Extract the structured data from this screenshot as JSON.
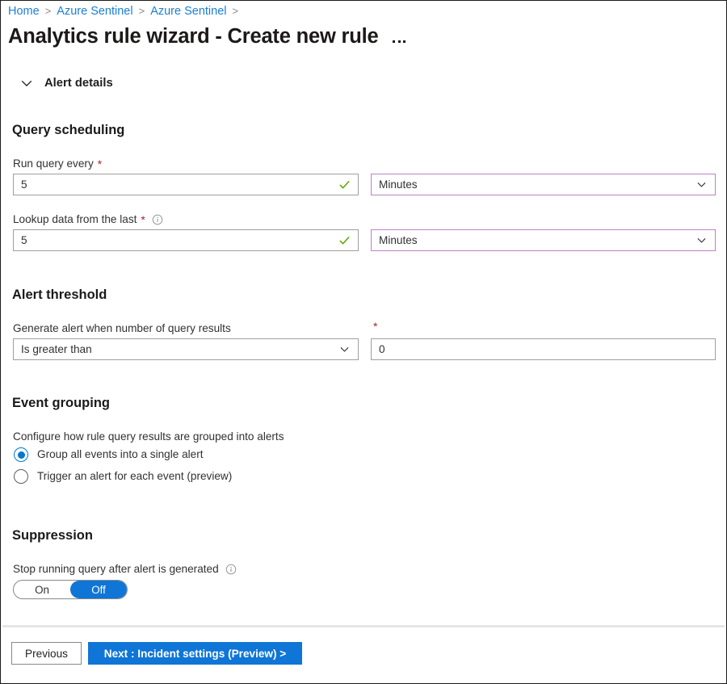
{
  "breadcrumb": {
    "items": [
      {
        "label": "Home"
      },
      {
        "label": "Azure Sentinel"
      },
      {
        "label": "Azure Sentinel"
      }
    ],
    "separator": ">"
  },
  "header": {
    "title": "Analytics rule wizard - Create new rule",
    "more_menu": "..."
  },
  "alert_details": {
    "label": "Alert details",
    "chevron": "chevron-down-icon"
  },
  "query_scheduling": {
    "heading": "Query scheduling",
    "run_query_every": {
      "label": "Run query every",
      "required": "*",
      "value": "5",
      "validation_icon": "checkmark-icon",
      "unit": "Minutes",
      "unit_chevron": "chevron-down-icon"
    },
    "lookup_data": {
      "label": "Lookup data from the last",
      "required": "*",
      "info_icon": "info-icon",
      "value": "5",
      "validation_icon": "checkmark-icon",
      "unit": "Minutes",
      "unit_chevron": "chevron-down-icon"
    }
  },
  "alert_threshold": {
    "heading": "Alert threshold",
    "operator_label": "Generate alert when number of query results",
    "operator_value": "Is greater than",
    "operator_chevron": "chevron-down-icon",
    "value_required": "*",
    "value": "0"
  },
  "event_grouping": {
    "heading": "Event grouping",
    "description": "Configure how rule query results are grouped into alerts",
    "options": [
      {
        "label": "Group all events into a single alert",
        "selected": true
      },
      {
        "label": "Trigger an alert for each event (preview)",
        "selected": false
      }
    ]
  },
  "suppression": {
    "heading": "Suppression",
    "label": "Stop running query after alert is generated",
    "info_icon": "info-icon",
    "toggle": {
      "on_label": "On",
      "off_label": "Off",
      "selected": "Off"
    }
  },
  "footer": {
    "previous_label": "Previous",
    "next_label": "Next : Incident settings (Preview)  >"
  },
  "colors": {
    "accent_blue": "#0f75d6",
    "link_blue": "#1a7fd4",
    "required_red": "#a4262c",
    "valid_green": "#5ca700",
    "dropdown_purple": "#bd82c4",
    "border_gray": "#a19f9d"
  }
}
